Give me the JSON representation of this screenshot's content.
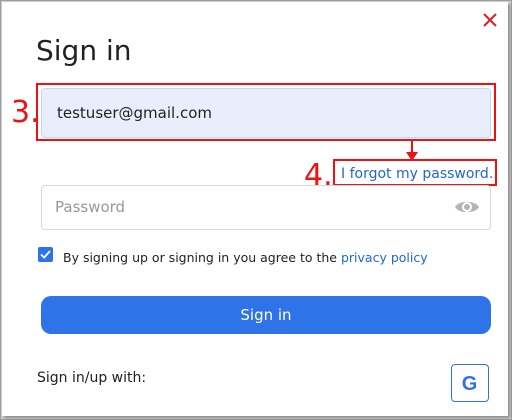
{
  "dialog": {
    "title": "Sign in",
    "email": {
      "value": "testuser@gmail.com"
    },
    "forgot_link": "I forgot my password.",
    "password": {
      "placeholder": "Password"
    },
    "agreement": {
      "checked": true,
      "text": "By signing up or signing in you agree to the ",
      "link": "privacy policy"
    },
    "signin_button": "Sign in",
    "signin_with_label": "Sign in/up with:",
    "google_button": "G"
  },
  "annotations": [
    {
      "label": "3.",
      "target": "email"
    },
    {
      "label": "4.",
      "target": "forgot_link"
    }
  ],
  "colors": {
    "accent": "#2f73e8",
    "annotation": "#ee1111",
    "link": "#1f67d2",
    "email_bg": "#e8eefc"
  },
  "icons": {
    "close": "close-icon",
    "eye": "eye-icon",
    "check": "checkmark-icon",
    "google": "google-icon"
  }
}
